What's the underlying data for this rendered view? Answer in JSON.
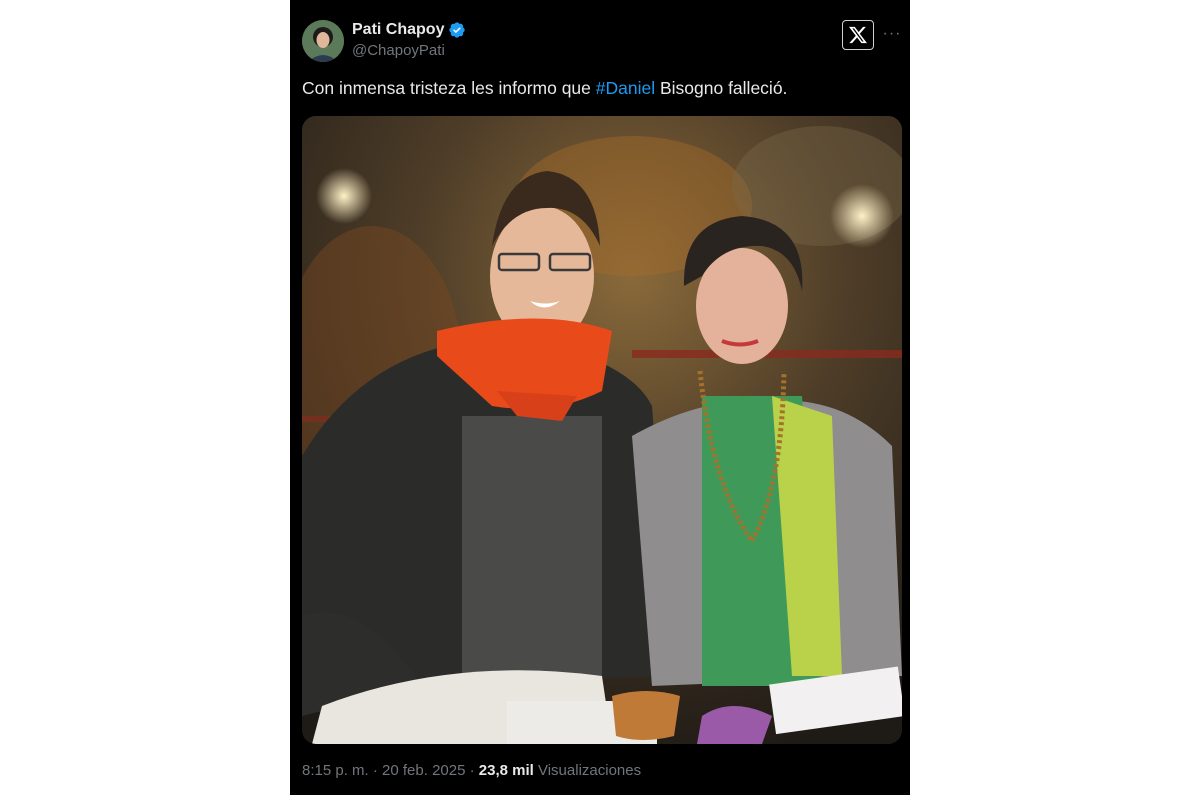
{
  "tweet": {
    "author_name": "Pati Chapoy",
    "author_handle": "@ChapoyPati",
    "text_before": "Con inmensa tristeza les informo que ",
    "hashtag": "#Daniel",
    "text_after": " Bisogno falleció.",
    "timestamp": "8:15 p. m. · 20 feb. 2025 · ",
    "views_count": "23,8 mil",
    "views_label": " Visualizaciones",
    "more_label": "···"
  },
  "icons": {
    "verified": "verified-badge-icon",
    "x_logo": "x-logo-icon",
    "more": "more-options-icon"
  },
  "colors": {
    "background": "#000000",
    "text": "#e7e9ea",
    "muted": "#71767b",
    "link": "#1d9bf0",
    "verified": "#1d9bf0"
  }
}
